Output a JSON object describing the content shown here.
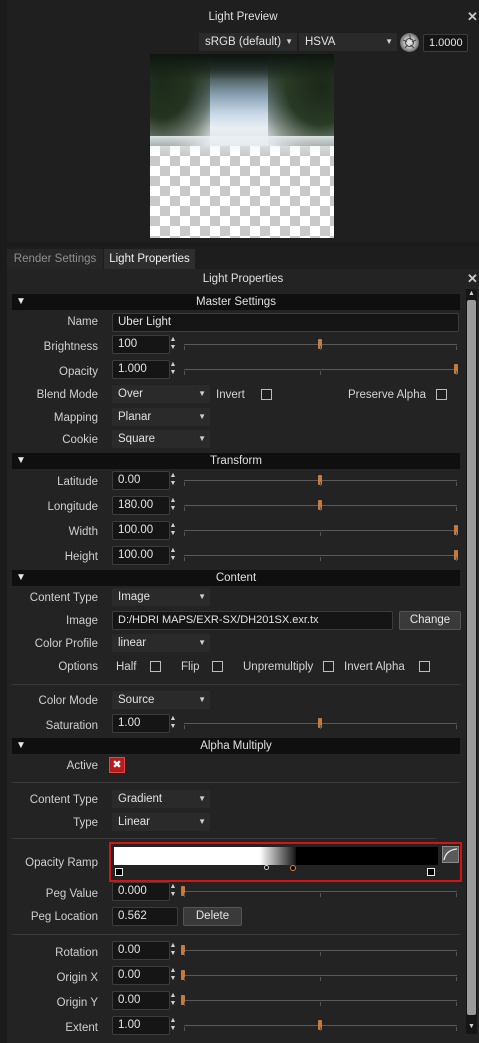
{
  "preview_panel": {
    "title": "Light Preview",
    "colorspace": "sRGB (default)",
    "channel_mode": "HSVA",
    "exposure": "1.0000"
  },
  "tabs": [
    {
      "label": "Render Settings"
    },
    {
      "label": "Light Properties"
    }
  ],
  "properties_panel": {
    "title": "Light Properties"
  },
  "master": {
    "section": "Master Settings",
    "name_label": "Name",
    "name_value": "Uber Light",
    "brightness_label": "Brightness",
    "brightness_value": "100",
    "brightness_level": 0.5,
    "opacity_label": "Opacity",
    "opacity_value": "1.000",
    "opacity_level": 1.0,
    "blend_label": "Blend Mode",
    "blend_value": "Over",
    "invert_label": "Invert",
    "preserve_alpha_label": "Preserve Alpha",
    "mapping_label": "Mapping",
    "mapping_value": "Planar",
    "cookie_label": "Cookie",
    "cookie_value": "Square"
  },
  "transform": {
    "section": "Transform",
    "latitude_label": "Latitude",
    "latitude_value": "0.00",
    "latitude_level": 0.5,
    "longitude_label": "Longitude",
    "longitude_value": "180.00",
    "longitude_level": 0.5,
    "width_label": "Width",
    "width_value": "100.00",
    "width_level": 1.0,
    "height_label": "Height",
    "height_value": "100.00",
    "height_level": 1.0
  },
  "content": {
    "section": "Content",
    "type_label": "Content Type",
    "type_value": "Image",
    "image_label": "Image",
    "image_value": "D:/HDRI MAPS/EXR-SX/DH201SX.exr.tx",
    "change_button": "Change",
    "profile_label": "Color Profile",
    "profile_value": "linear",
    "options_label": "Options",
    "half_label": "Half",
    "flip_label": "Flip",
    "unpremultiply_label": "Unpremultiply",
    "invert_alpha_label": "Invert Alpha",
    "color_mode_label": "Color Mode",
    "color_mode_value": "Source",
    "saturation_label": "Saturation",
    "saturation_value": "1.00",
    "saturation_level": 0.5
  },
  "alpha": {
    "section": "Alpha Multiply",
    "active_label": "Active",
    "active_mark": "✖",
    "type_label": "Content Type",
    "type_value": "Gradient",
    "subtype_label": "Type",
    "subtype_value": "Linear",
    "ramp_label": "Opacity Ramp",
    "peg_value_label": "Peg Value",
    "peg_value": "0.000",
    "peg_value_level": 0.0,
    "peg_location_label": "Peg Location",
    "peg_location": "0.562",
    "delete_button": "Delete",
    "rotation_label": "Rotation",
    "rotation_value": "0.00",
    "rotation_level": 0.0,
    "origin_x_label": "Origin X",
    "origin_x_value": "0.00",
    "origin_x_level": 0.0,
    "origin_y_label": "Origin Y",
    "origin_y_value": "0.00",
    "origin_y_level": 0.0,
    "extent_label": "Extent",
    "extent_value": "1.00",
    "extent_level": 0.5
  },
  "icons": {
    "close": "close-icon",
    "exposure": "aperture-icon",
    "dropdown": "chevron-down-icon",
    "collapse": "triangle-down-icon",
    "curve": "curve-icon"
  },
  "colors": {
    "accent": "#c87a3c",
    "highlight_border": "#d11414"
  }
}
